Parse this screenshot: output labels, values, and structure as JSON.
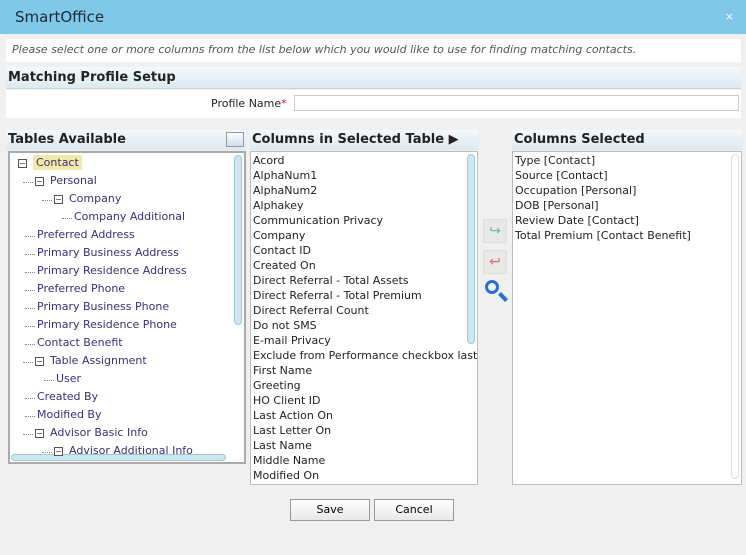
{
  "window": {
    "title": "SmartOffice",
    "close": "×"
  },
  "info": "Please select one or more columns from the list below which you would like to use for finding matching contacts.",
  "section_title": "Matching Profile Setup",
  "profile": {
    "label": "Profile Name",
    "required": "*",
    "value": ""
  },
  "tables": {
    "header": "Tables Available",
    "items": [
      {
        "label": "Contact",
        "level": 0,
        "expand": true,
        "selected": true
      },
      {
        "label": "Personal",
        "level": 1,
        "expand": true
      },
      {
        "label": "Company",
        "level": 2,
        "expand": true
      },
      {
        "label": "Company Additional",
        "level": 3
      },
      {
        "label": "Preferred Address",
        "level": 1
      },
      {
        "label": "Primary Business Address",
        "level": 1
      },
      {
        "label": "Primary Residence Address",
        "level": 1
      },
      {
        "label": "Preferred Phone",
        "level": 1
      },
      {
        "label": "Primary Business Phone",
        "level": 1
      },
      {
        "label": "Primary Residence Phone",
        "level": 1
      },
      {
        "label": "Contact Benefit",
        "level": 1
      },
      {
        "label": "Table Assignment",
        "level": 1,
        "expand": true
      },
      {
        "label": "User",
        "level": 2
      },
      {
        "label": "Created By",
        "level": 1
      },
      {
        "label": "Modified By",
        "level": 1
      },
      {
        "label": "Advisor Basic Info",
        "level": 1,
        "expand": true
      },
      {
        "label": "Advisor Additional Info",
        "level": 2,
        "expand": true
      }
    ]
  },
  "columns": {
    "header": "Columns in Selected Table ▶",
    "items": [
      "Acord",
      "AlphaNum1",
      "AlphaNum2",
      "Alphakey",
      "Communication Privacy",
      "Company",
      "Contact ID",
      "Created On",
      "Direct Referral - Total Assets",
      "Direct Referral - Total Premium",
      "Direct Referral Count",
      "Do not SMS",
      "E-mail Privacy",
      "Exclude from Performance checkbox last n",
      "First Name",
      "Greeting",
      "HO Client ID",
      "Last Action On",
      "Last Letter On",
      "Last Name",
      "Middle Name",
      "Modified On"
    ]
  },
  "selected": {
    "header": "Columns Selected",
    "items": [
      "Type [Contact]",
      "Source [Contact]",
      "Occupation [Personal]",
      "DOB [Personal]",
      "Review Date [Contact]",
      "Total Premium [Contact Benefit]"
    ]
  },
  "buttons": {
    "save": "Save",
    "cancel": "Cancel"
  },
  "colors": {
    "titlebar": "#7ec8ea",
    "add": "#5cc89a",
    "remove": "#e07070",
    "search": "#2a6fd0"
  }
}
